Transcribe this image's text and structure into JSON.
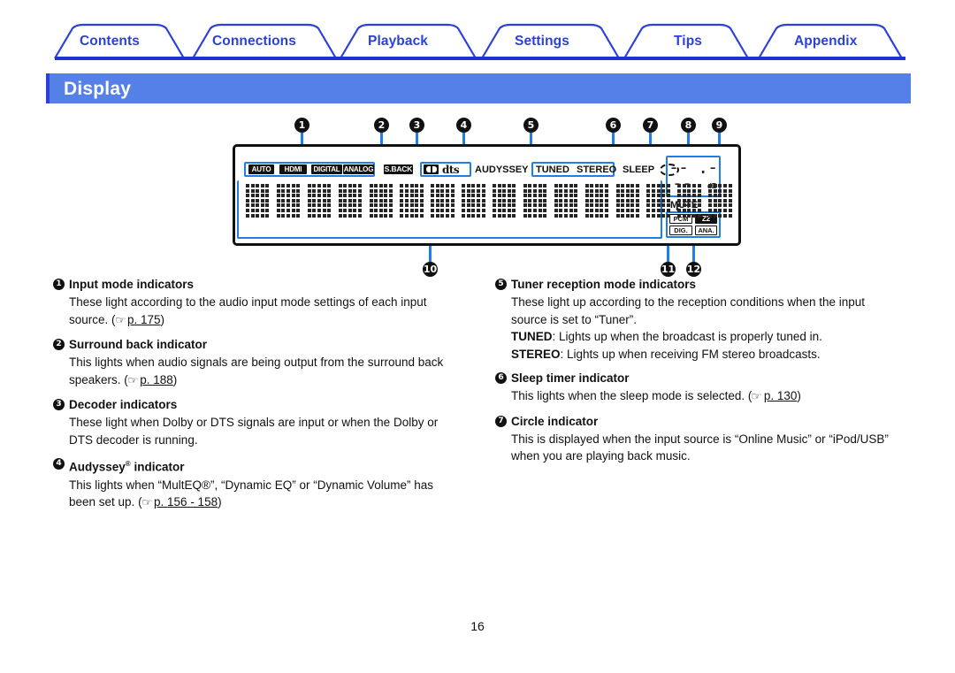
{
  "tabs": [
    {
      "label": "Contents"
    },
    {
      "label": "Connections"
    },
    {
      "label": "Playback"
    },
    {
      "label": "Settings"
    },
    {
      "label": "Tips"
    },
    {
      "label": "Appendix"
    }
  ],
  "page_title": "Display",
  "accent_color": "#2b41d8",
  "title_bar_color": "#5580e8",
  "callout_blue": "#1f7fe8",
  "diagram": {
    "top_callouts": [
      "1",
      "2",
      "3",
      "4",
      "5",
      "6",
      "7",
      "8",
      "9"
    ],
    "bottom_callouts": [
      "10",
      "11",
      "12"
    ],
    "indicators": {
      "input_mode": [
        "AUTO",
        "HDMI",
        "DIGITAL",
        "ANALOG"
      ],
      "surround_back": "S.BACK",
      "decoder_dolby": "dolby-double-d-logo",
      "decoder_dts": "dts",
      "audyssey": "AUDYSSEY",
      "tuner": [
        "TUNED",
        "STEREO"
      ],
      "sleep": "SLEEP",
      "circle": "circle-indicator",
      "volume_value": "-- .-",
      "volume_unit": "dB",
      "mute": "MUTE",
      "signal": [
        "PCM",
        "Z2",
        "DIG.",
        "ANA."
      ]
    },
    "matrix_cells": 16
  },
  "left_column": [
    {
      "num": "1",
      "heading": "Input mode indicators",
      "body_lines": [
        "These light according to the audio input mode settings of each input",
        "source."
      ],
      "ref": "p. 175",
      "ref_open": "(",
      "ref_close": ")"
    },
    {
      "num": "2",
      "heading": "Surround back indicator",
      "body_lines": [
        "This lights when audio signals are being output from the surround back",
        "speakers."
      ],
      "ref": "p. 188",
      "ref_open": "(",
      "ref_close": ")"
    },
    {
      "num": "3",
      "heading": "Decoder indicators",
      "body_lines": [
        "These light when Dolby or DTS signals are input or when the Dolby or",
        "DTS decoder is running."
      ],
      "ref": "",
      "ref_open": "",
      "ref_close": ""
    },
    {
      "num": "4",
      "heading": "Audyssey",
      "heading_sup": "®",
      "heading_tail": " indicator",
      "body_lines": [
        "This lights when “MultEQ®”, “Dynamic EQ” or “Dynamic Volume” has",
        "been set up."
      ],
      "ref": "p. 156 - 158",
      "ref_open": "(",
      "ref_close": ")"
    }
  ],
  "right_column": [
    {
      "num": "5",
      "heading": "Tuner reception mode indicators",
      "body_lines": [
        "These light up according to the reception conditions when the input",
        "source is set to “Tuner”."
      ],
      "bold_lines": [
        {
          "label": "TUNED",
          "text": ": Lights up when the broadcast is properly tuned in."
        },
        {
          "label": "STEREO",
          "text": ": Lights up when receiving FM stereo broadcasts."
        }
      ],
      "ref": "",
      "ref_open": "",
      "ref_close": ""
    },
    {
      "num": "6",
      "heading": "Sleep timer indicator",
      "body_lines": [
        "This lights when the sleep mode is selected."
      ],
      "ref": "p. 130",
      "ref_open": "(",
      "ref_close": ")"
    },
    {
      "num": "7",
      "heading": "Circle indicator",
      "body_lines": [
        "This is displayed when the input source is “Online Music” or “iPod/USB”",
        "when you are playing back music."
      ],
      "ref": "",
      "ref_open": "",
      "ref_close": ""
    }
  ],
  "page_number": "16"
}
